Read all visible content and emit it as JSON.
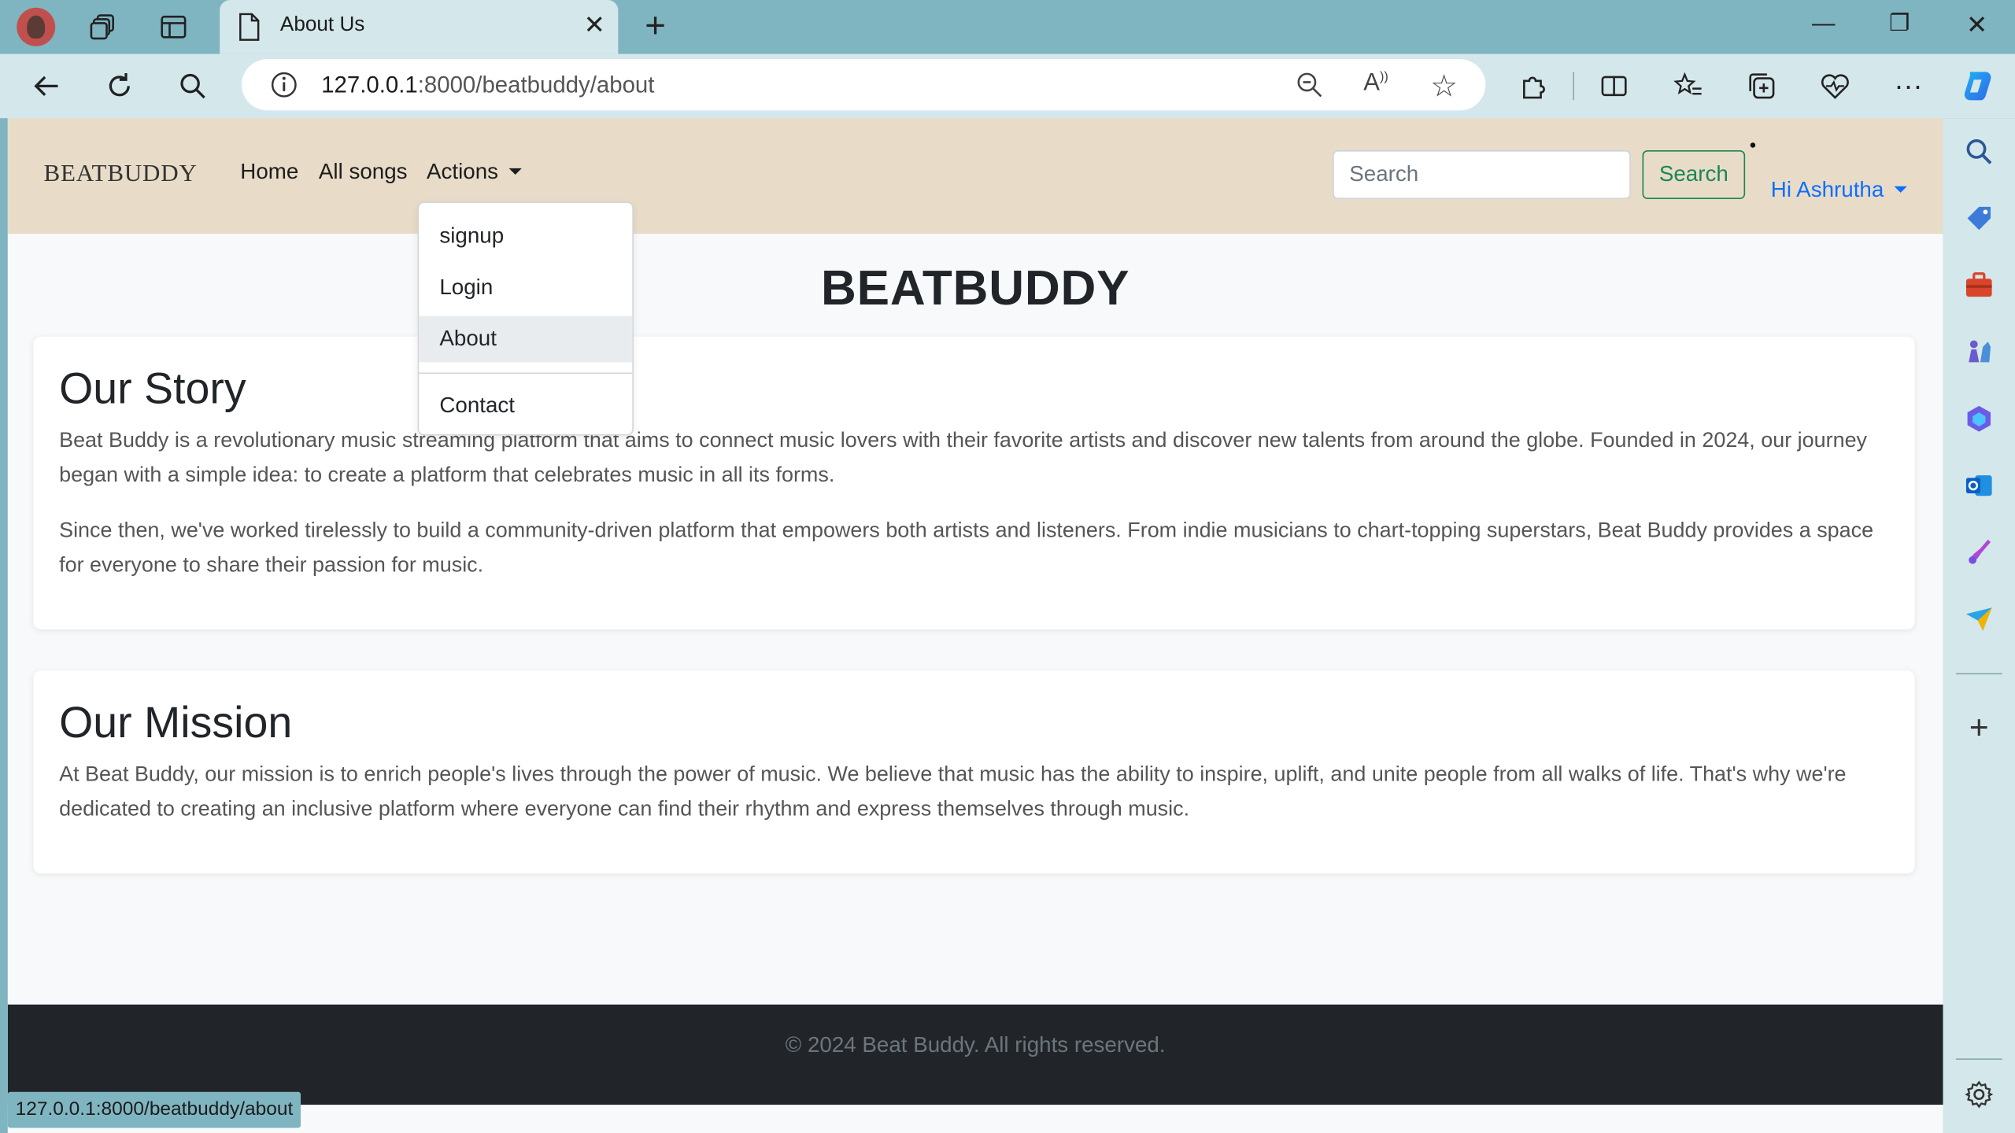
{
  "browser": {
    "tab_title": "About Us",
    "url_host": "127.0.0.1",
    "url_rest": ":8000/beatbuddy/about",
    "status_url": "127.0.0.1:8000/beatbuddy/about"
  },
  "site": {
    "brand": "BEATBUDDY",
    "nav": {
      "home": "Home",
      "all_songs": "All songs",
      "actions": "Actions"
    },
    "dropdown": {
      "signup": "signup",
      "login": "Login",
      "about": "About",
      "contact": "Contact"
    },
    "search": {
      "placeholder": "Search",
      "button": "Search"
    },
    "user_greeting": "Hi Ashrutha",
    "page_title": "BEATBUDDY",
    "story": {
      "heading": "Our Story",
      "p1": "Beat Buddy is a revolutionary music streaming platform that aims to connect music lovers with their favorite artists and discover new talents from around the globe. Founded in 2024, our journey began with a simple idea: to create a platform that celebrates music in all its forms.",
      "p2": "Since then, we've worked tirelessly to build a community-driven platform that empowers both artists and listeners. From indie musicians to chart-topping superstars, Beat Buddy provides a space for everyone to share their passion for music."
    },
    "mission": {
      "heading": "Our Mission",
      "p1": "At Beat Buddy, our mission is to enrich people's lives through the power of music. We believe that music has the ability to inspire, uplift, and unite people from all walks of life. That's why we're dedicated to creating an inclusive platform where everyone can find their rhythm and express themselves through music."
    },
    "footer": "© 2024 Beat Buddy. All rights reserved."
  },
  "colors": {
    "chrome": "#7fb5c1",
    "navbar": "#e8dcc8",
    "accent_green": "#198754",
    "accent_blue": "#0d6efd",
    "footer": "#212529"
  }
}
